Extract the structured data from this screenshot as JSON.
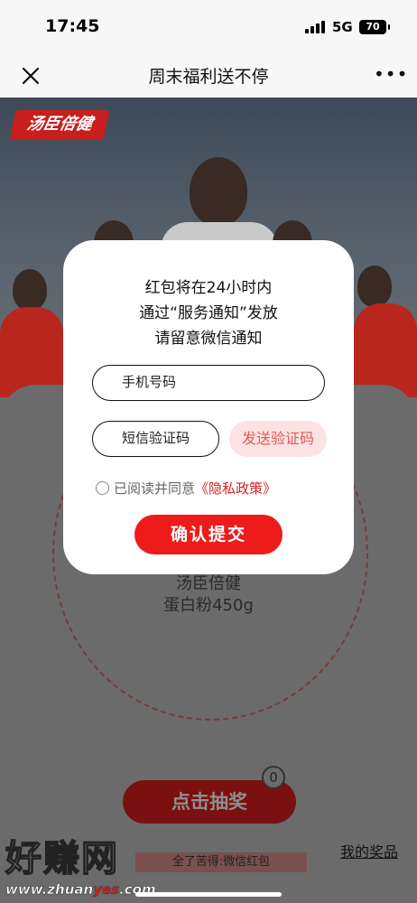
{
  "status_bar": {
    "time": "17:45",
    "network": "5G",
    "battery": "70"
  },
  "nav": {
    "title": "周末福利送不停",
    "close_icon": "close-icon",
    "more_icon": "more-icon"
  },
  "banner": {
    "brand": "汤臣倍健"
  },
  "wheel": {
    "prize_line1": "汤臣倍健",
    "prize_line2": "蛋白粉450g"
  },
  "draw": {
    "button": "点击抽奖",
    "count": "0",
    "ticker": "全了苦得:微信红包",
    "my_prizes": "我的奖品"
  },
  "watermark": {
    "main": "好赚网",
    "sub_pre": "www.zhuan",
    "sub_hl": "yes",
    "sub_post": ".com"
  },
  "modal": {
    "line1": "红包将在24小时内",
    "line2": "通过“服务通知”发放",
    "line3": "请留意微信通知",
    "phone_placeholder": "手机号码",
    "code_placeholder": "短信验证码",
    "send_code": "发送验证码",
    "agree_text": "已阅读并同意",
    "policy_link": "《隐私政策》",
    "submit": "确认提交"
  },
  "colors": {
    "accent": "#ee1b1b",
    "send_bg": "#fbe3e3",
    "overlay": "#6b6b6b"
  }
}
